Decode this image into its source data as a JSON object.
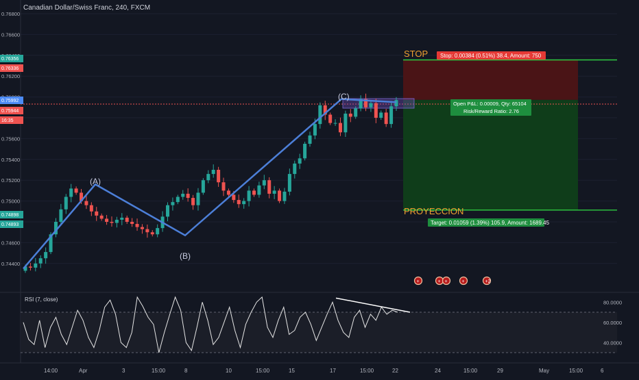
{
  "header": {
    "symbol_title": "Canadian Dollar/Swiss Franc, 240, FXCM"
  },
  "price_axis": {
    "ticks": [
      "0.76800",
      "0.76600",
      "0.76400",
      "0.76200",
      "0.76000",
      "0.75800",
      "0.75600",
      "0.75400",
      "0.75200",
      "0.75000",
      "0.74800",
      "0.74600",
      "0.74400"
    ],
    "badges": [
      {
        "label": "0.76356",
        "color": "#26a69a"
      },
      {
        "label": "0.76336",
        "color": "#ef5350"
      },
      {
        "label": "0.75992",
        "color": "#4c8bf5"
      },
      {
        "label": "0.75944",
        "color": "#ef5350"
      },
      {
        "label": "16:35",
        "color": "#ef5350"
      },
      {
        "label": "0.74898",
        "color": "#26a69a"
      },
      {
        "label": "0.74893",
        "color": "#26a69a"
      }
    ]
  },
  "time_axis": {
    "labels": [
      "14:00",
      "Apr",
      "3",
      "15:00",
      "8",
      "10",
      "15:00",
      "15",
      "17",
      "15:00",
      "22",
      "24",
      "15:00",
      "29",
      "May",
      "15:00",
      "6"
    ]
  },
  "waves": {
    "A": "(A)",
    "B": "(B)",
    "C": "(C)"
  },
  "position": {
    "stop_text": "STOP",
    "target_text": "PROYECCION",
    "stop_label": "Stop: 0.00384 (0.51%) 38.4, Amount: 750",
    "pnl_line1": "Open P&L: 0.00009, Qty: 65104",
    "pnl_line2": "Risk/Reward Ratio: 2.76",
    "target_label": "Target: 0.01059 (1.39%) 105.9, Amount: 1689.45",
    "stop_price": 0.76356,
    "entry_price": 0.75972,
    "target_price": 0.74913
  },
  "rsi": {
    "title": "RSI (7, close)",
    "ticks": [
      "80.0000",
      "60.0000",
      "40.0000"
    ],
    "upper": 70,
    "lower": 30
  },
  "event_icons": [
    "+",
    "+",
    "+",
    "+",
    "+2"
  ],
  "colors": {
    "bg": "#131722",
    "up": "#26a69a",
    "down": "#ef5350",
    "wave": "#4c7fd8",
    "stop_zone": "#4a1416",
    "target_zone": "#0f3d1a",
    "line_green": "#2ecc40"
  },
  "chart_data": {
    "type": "line",
    "title": "Canadian Dollar/Swiss Franc, 240, FXCM",
    "ylim": [
      0.743,
      0.7683
    ],
    "wave_points": [
      {
        "label": "start",
        "x": "14:00",
        "y": 0.7435
      },
      {
        "label": "(A)",
        "x": "Apr",
        "y": 0.7516
      },
      {
        "label": "(B)",
        "x": "8",
        "y": 0.7467
      },
      {
        "label": "(C)",
        "x": "17",
        "y": 0.7598
      },
      {
        "label": "end",
        "x": "22",
        "y": 0.7595
      }
    ],
    "close_series": [
      0.7437,
      0.7436,
      0.744,
      0.7445,
      0.7451,
      0.7468,
      0.748,
      0.7492,
      0.7504,
      0.7512,
      0.7508,
      0.75,
      0.7496,
      0.749,
      0.7486,
      0.7483,
      0.748,
      0.7479,
      0.7482,
      0.7484,
      0.748,
      0.7478,
      0.7475,
      0.7473,
      0.747,
      0.7468,
      0.7474,
      0.7485,
      0.7496,
      0.7499,
      0.7504,
      0.7507,
      0.7503,
      0.7496,
      0.7508,
      0.752,
      0.7526,
      0.753,
      0.7518,
      0.751,
      0.7506,
      0.7501,
      0.7497,
      0.75,
      0.751,
      0.7506,
      0.7515,
      0.752,
      0.7507,
      0.751,
      0.75,
      0.7509,
      0.7526,
      0.7536,
      0.7541,
      0.7555,
      0.7563,
      0.7574,
      0.7592,
      0.7583,
      0.7575,
      0.7575,
      0.7566,
      0.7584,
      0.7581,
      0.7589,
      0.7598,
      0.759,
      0.7594,
      0.758,
      0.7585,
      0.7574,
      0.7591,
      0.7597
    ],
    "rsi_series": [
      60,
      43,
      38,
      62,
      35,
      55,
      65,
      48,
      38,
      55,
      72,
      62,
      45,
      35,
      52,
      75,
      82,
      68,
      40,
      35,
      50,
      85,
      76,
      65,
      58,
      30,
      50,
      68,
      85,
      72,
      40,
      32,
      55,
      80,
      62,
      38,
      45,
      60,
      75,
      52,
      35,
      58,
      70,
      80,
      85,
      55,
      45,
      62,
      75,
      48,
      52,
      65,
      70,
      58,
      42,
      55,
      68,
      80,
      62,
      50,
      45,
      65,
      72,
      55,
      68,
      62,
      75,
      68,
      72,
      70
    ],
    "rsi_divergence": [
      {
        "rsi": 84
      },
      {
        "rsi": 70
      }
    ]
  }
}
